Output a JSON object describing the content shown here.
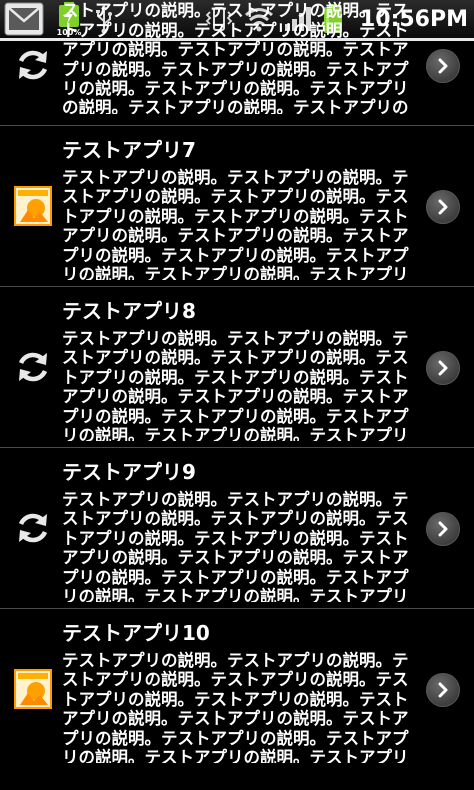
{
  "statusbar": {
    "battery_small_label": "100%",
    "time": "10:56PM",
    "icons": [
      "mail-icon",
      "battery-charging-icon",
      "usb-icon",
      "vibrate-icon",
      "wifi-icon",
      "signal-icon",
      "battery-icon"
    ],
    "accent_green": "#7fd12a"
  },
  "apps": [
    {
      "title": "",
      "icon": "sync-icon",
      "description": "テストアプリの説明。テストアプリの説明。テストアプリの説明。テストアプリの説明。テストアプリの説明。テストアプリの説明。テストアプリの説明。テストアプリの説明。テストアプリの説明。テストアプリの説明。テストアプリの説明。テストアプリの説明。テストアプリの説明。テストアプリの説明。テストアプリの説明。テストアプリの説明。"
    },
    {
      "title": "テストアプリ7",
      "icon": "image-app-icon",
      "description": "テストアプリの説明。テストアプリの説明。テストアプリの説明。テストアプリの説明。テストアプリの説明。テストアプリの説明。テストアプリの説明。テストアプリの説明。テストアプリの説明。テストアプリの説明。テストアプリの説明。テストアプリの説明。テストアプリの説明。テストアプリの説明。テストアプリの説明。テストアプリの説明。"
    },
    {
      "title": "テストアプリ8",
      "icon": "sync-icon",
      "description": "テストアプリの説明。テストアプリの説明。テストアプリの説明。テストアプリの説明。テストアプリの説明。テストアプリの説明。テストアプリの説明。テストアプリの説明。テストアプリの説明。テストアプリの説明。テストアプリの説明。テストアプリの説明。テストアプリの説明。テストアプリの説明。テストアプリの説明。テストアプリの説明。"
    },
    {
      "title": "テストアプリ9",
      "icon": "sync-icon",
      "description": "テストアプリの説明。テストアプリの説明。テストアプリの説明。テストアプリの説明。テストアプリの説明。テストアプリの説明。テストアプリの説明。テストアプリの説明。テストアプリの説明。テストアプリの説明。テストアプリの説明。テストアプリの説明。テストアプリの説明。テストアプリの説明。テストアプリの説明。テストアプリの説明。"
    },
    {
      "title": "テストアプリ10",
      "icon": "image-app-icon",
      "description": "テストアプリの説明。テストアプリの説明。テストアプリの説明。テストアプリの説明。テストアプリの説明。テストアプリの説明。テストアプリの説明。テストアプリの説明。テストアプリの説明。テストアプリの説明。テストアプリの説明。テストアプリの説明。テストアプリの説明。テストアプリの説明。テストアプリの説明。テストアプリの説明。"
    }
  ],
  "colors": {
    "background": "#000000",
    "text": "#ffffff",
    "divider": "#4a4a4a"
  }
}
